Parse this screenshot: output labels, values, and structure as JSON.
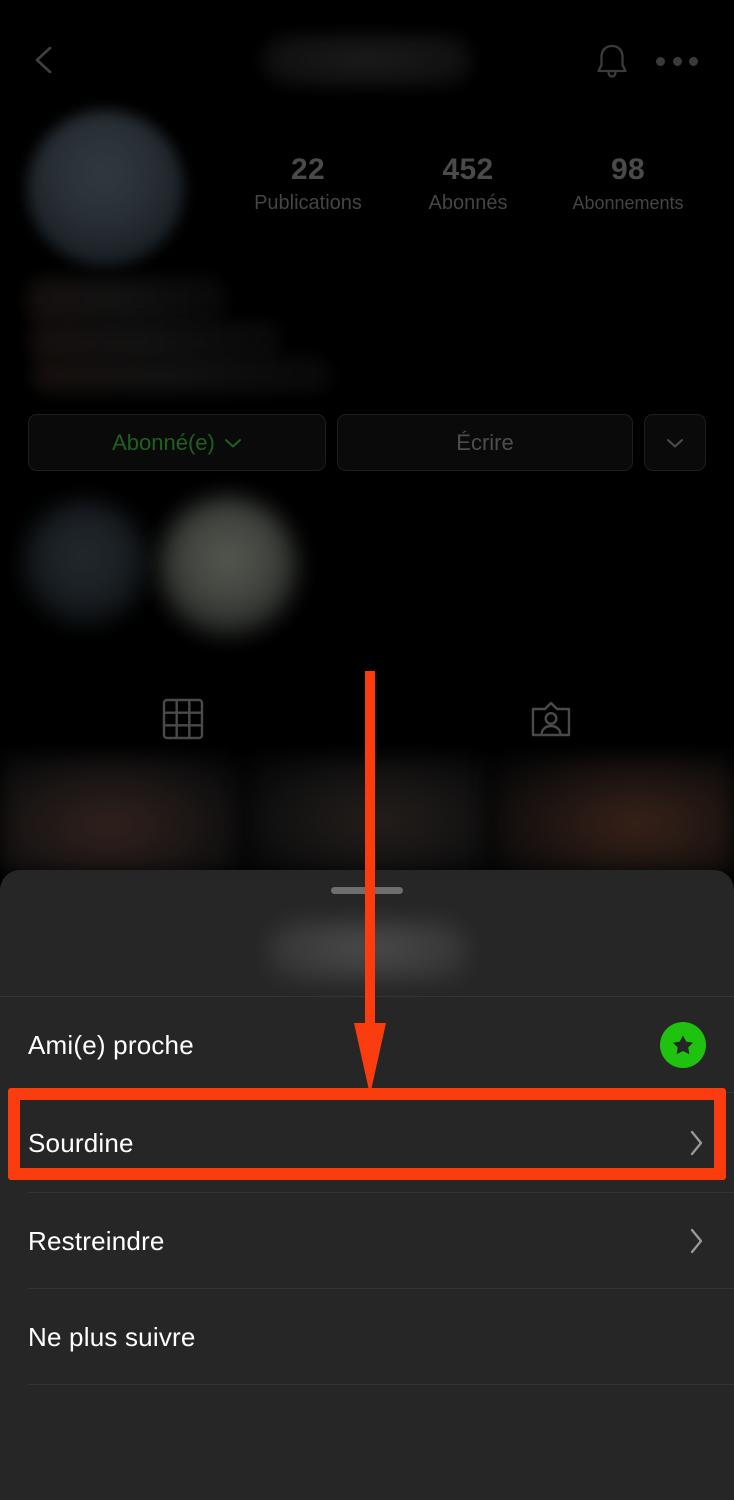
{
  "app": {
    "name": "Instagram",
    "language": "fr"
  },
  "topbar": {
    "back_icon": "chevron-left-icon",
    "title": "",
    "title_redacted": true,
    "notifications_icon": "bell-icon",
    "overflow_icon": "more-dots-icon"
  },
  "profile": {
    "avatar_alt": "profile-photo",
    "name_redacted": true,
    "bio_redacted": true,
    "stats": [
      {
        "value": "22",
        "label": "Publications"
      },
      {
        "value": "452",
        "label": "Abonnés"
      },
      {
        "value": "98",
        "label": "Abonnements"
      }
    ],
    "actions": [
      {
        "label": "Abonné(e)",
        "icon": "chevron-down-icon",
        "style": "following",
        "color": "#1f6020"
      },
      {
        "label": "Écrire",
        "icon": "",
        "style": "default",
        "color": "#4d4d4d"
      },
      {
        "label": "",
        "icon": "chevron-down-icon",
        "style": "default",
        "color": "#4d4d4d"
      }
    ],
    "tabs": [
      {
        "icon": "grid-icon",
        "name": "posts-tab",
        "active": true
      },
      {
        "icon": "tagged-person-icon",
        "name": "tagged-tab",
        "active": false
      }
    ]
  },
  "sheet": {
    "handle": "drag-handle",
    "header_redacted": true,
    "items": [
      {
        "label": "Ami(e) proche",
        "name": "close-friend",
        "accessory": "green-star-badge",
        "accessory_color": "#1fc20e",
        "highlighted": false
      },
      {
        "label": "Sourdine",
        "name": "mute",
        "accessory": "chevron-right-icon",
        "accessory_color": "#9a9a9a",
        "highlighted": true
      },
      {
        "label": "Restreindre",
        "name": "restrict",
        "accessory": "chevron-right-icon",
        "accessory_color": "#9a9a9a",
        "highlighted": false
      },
      {
        "label": "Ne plus suivre",
        "name": "unfollow",
        "accessory": "",
        "accessory_color": "",
        "highlighted": false
      }
    ]
  },
  "annotations": {
    "arrow": {
      "name": "red-down-arrow",
      "color": "#fa3c0f",
      "points_to": "Sourdine"
    },
    "highlight_box": {
      "name": "red-highlight-rectangle",
      "color": "#fa3c0f",
      "target": "Sourdine"
    }
  }
}
